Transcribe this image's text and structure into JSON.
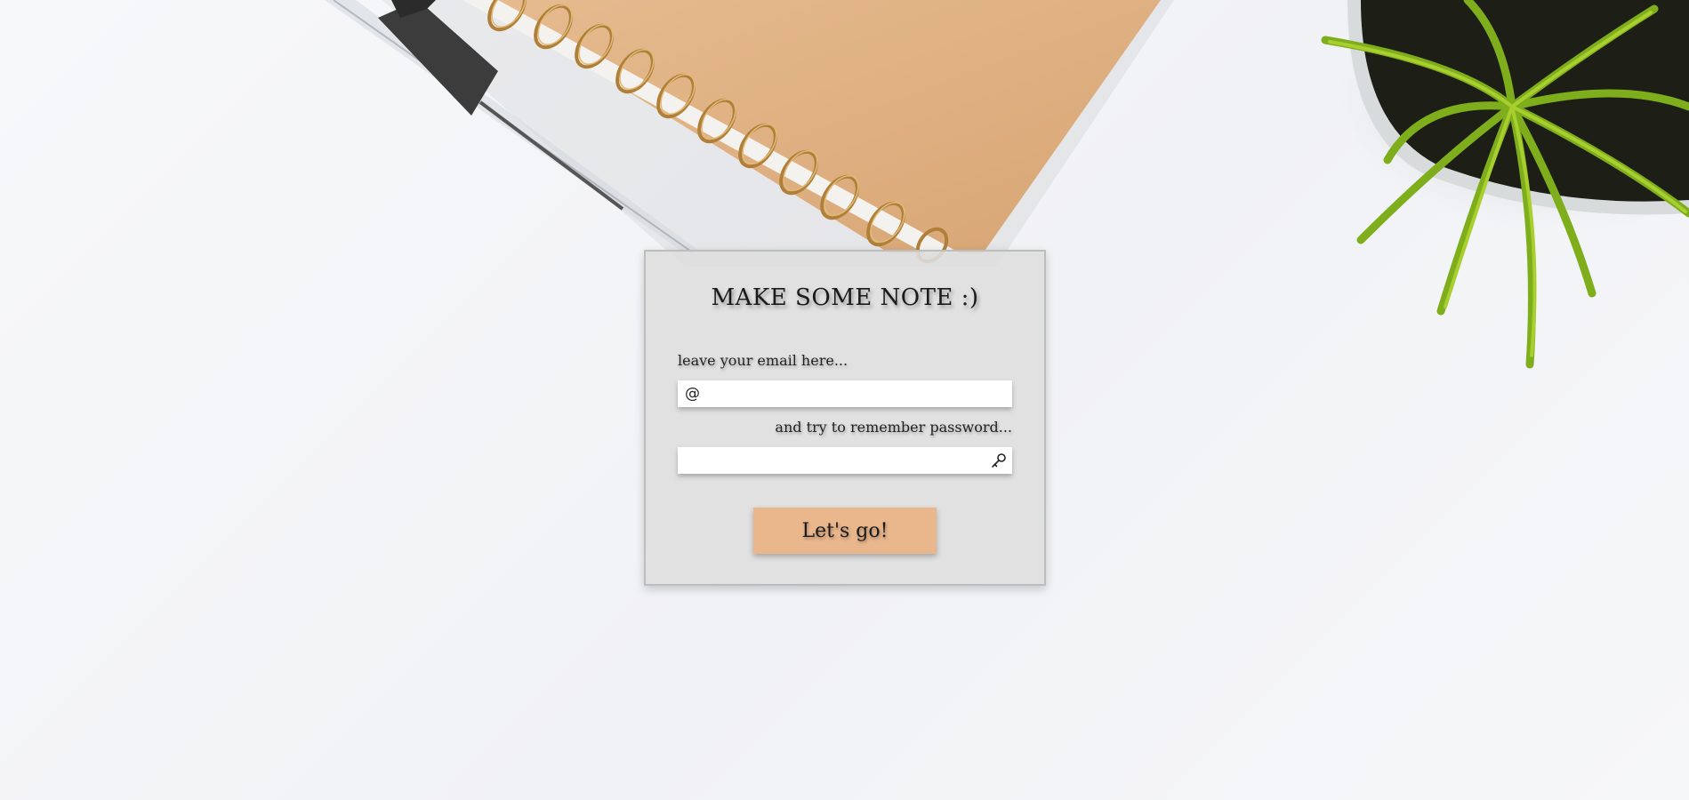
{
  "form": {
    "title": "MAKE SOME NOTE :)",
    "email_label": "leave your email here...",
    "email_value": "",
    "email_icon": "@",
    "password_label": "and try to remember password...",
    "password_value": "",
    "submit_label": "Let's go!"
  },
  "icons": {
    "email": "at-icon",
    "password": "key-icon"
  },
  "colors": {
    "button": "#eab78d",
    "card": "#dedede",
    "notebook": "#dcaa78",
    "plant": "#7fae1c"
  }
}
